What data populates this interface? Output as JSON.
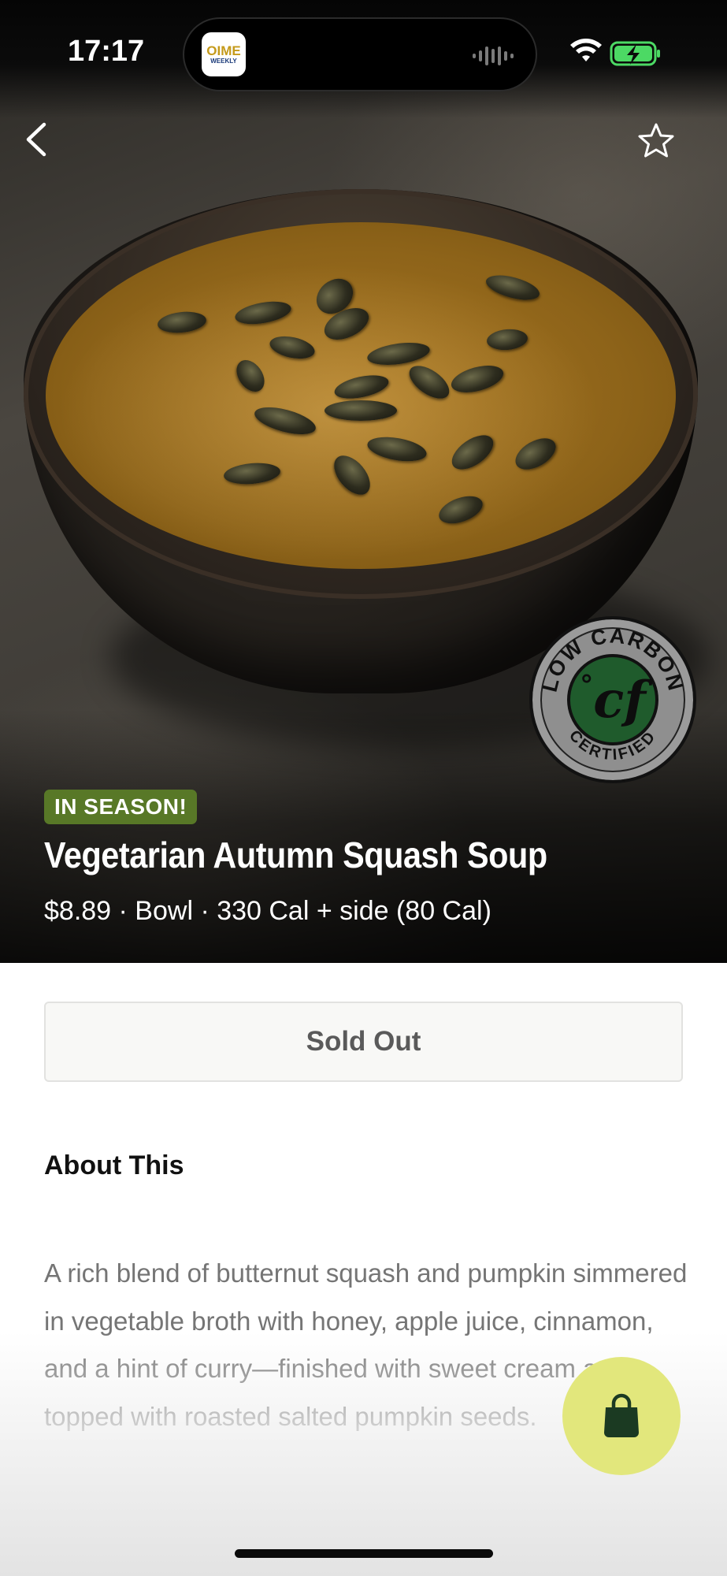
{
  "status_bar": {
    "time": "17:17",
    "live_activity_app": {
      "line1": "OIME",
      "line2": "WEEKLY"
    },
    "icons": [
      "waveform-icon",
      "wifi-icon",
      "battery-charging-icon"
    ]
  },
  "nav": {
    "back_icon": "chevron-left-icon",
    "favorite_icon": "star-outline-icon"
  },
  "hero": {
    "badge": "IN SEASON!",
    "title": "Vegetarian Autumn Squash Soup",
    "meta": "$8.89 · Bowl · 330 Cal + side (80 Cal)",
    "certification": {
      "top_text": "LOW CARBON",
      "bottom_text": "CERTIFIED",
      "logo_text": "cf",
      "degree": "°"
    }
  },
  "action": {
    "label": "Sold Out"
  },
  "about": {
    "heading": "About This",
    "text": "A rich blend of butternut squash and pumpkin simmered in vegetable broth with honey, apple juice, cinnamon, and a hint of curry—finished with sweet cream and topped with roasted salted pumpkin seeds."
  },
  "cart": {
    "icon": "shopping-bag-icon"
  },
  "colors": {
    "badge_bg": "#587827",
    "cart_fab_bg": "#e2e77c",
    "cf_inner": "#1f5b2c",
    "cart_icon": "#1b3a22"
  }
}
